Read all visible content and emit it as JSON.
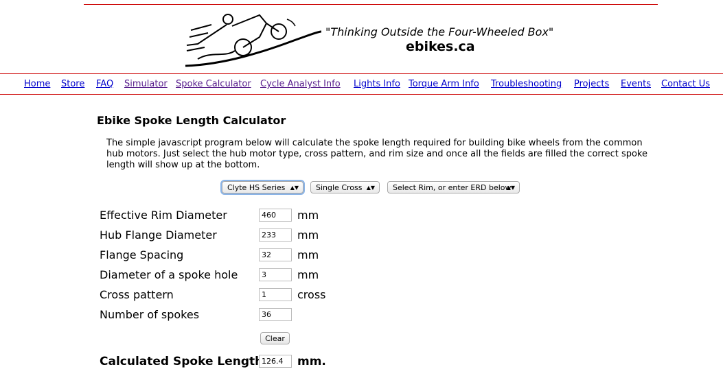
{
  "header": {
    "tagline": "\"Thinking Outside the Four-Wheeled Box\"",
    "site": "ebikes.ca",
    "logo": "ebike rider illustration"
  },
  "nav": [
    {
      "label": "Home"
    },
    {
      "label": "Store"
    },
    {
      "label": "FAQ"
    },
    {
      "label": "Simulator"
    },
    {
      "label": "Spoke Calculator"
    },
    {
      "label": "Cycle Analyst Info"
    },
    {
      "label": "Lights Info"
    },
    {
      "label": "Torque Arm Info"
    },
    {
      "label": "Troubleshooting"
    },
    {
      "label": "Projects"
    },
    {
      "label": "Events"
    },
    {
      "label": "Contact Us"
    }
  ],
  "page": {
    "title": "Ebike Spoke Length Calculator",
    "intro": "The simple javascript program below will calculate the spoke length required for building bike wheels from the common hub motors. Just select the hub motor type, cross pattern, and rim size and once all the fields are filled the correct spoke length will show up at the bottom."
  },
  "selects": {
    "motor": "Clyte HS Series",
    "cross": "Single Cross",
    "rim": "Select Rim, or enter ERD below"
  },
  "fields": [
    {
      "label": "Effective Rim Diameter",
      "value": "460",
      "unit": "mm"
    },
    {
      "label": "Hub Flange Diameter",
      "value": "233",
      "unit": "mm"
    },
    {
      "label": "Flange Spacing",
      "value": "32",
      "unit": "mm"
    },
    {
      "label": "Diameter of a spoke hole",
      "value": "3",
      "unit": "mm"
    },
    {
      "label": "Cross pattern",
      "value": "1",
      "unit": "cross"
    },
    {
      "label": "Number of spokes",
      "value": "36",
      "unit": ""
    }
  ],
  "clear_label": "Clear",
  "result": {
    "label": "Calculated Spoke Length:",
    "value": "126.4",
    "unit": "mm."
  },
  "colors": {
    "rule": "#cc0000",
    "link": "#0000cc",
    "visited": "#551a8b"
  }
}
